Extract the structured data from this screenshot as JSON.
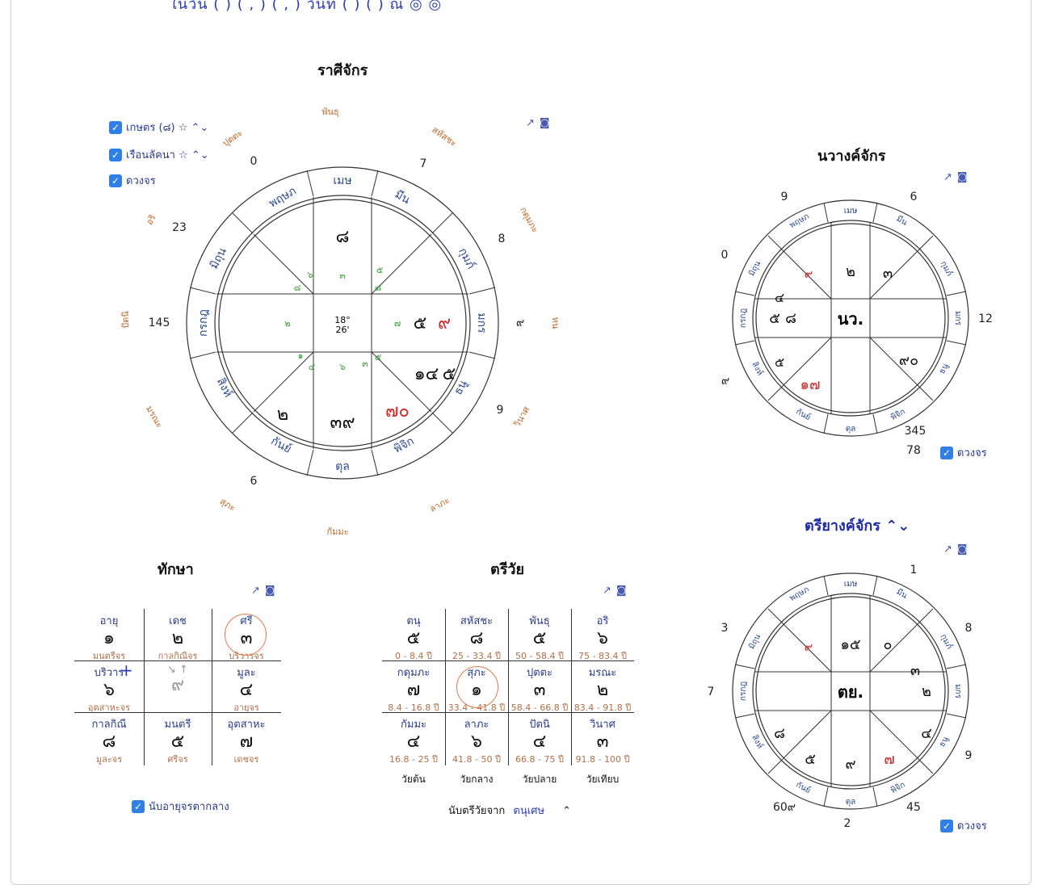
{
  "top_line": "ในวัน (     )  (          ,    )  (     ,          )  วันที่ (        ) (        )  ณ ◎ ◎",
  "rasi": {
    "title": "ราศีจักร",
    "cb1": "เกษตร (๘) ☆ ⌃⌄",
    "cb2": "เรือนลัคนา ☆ ⌃⌄",
    "cb3": "ดวงจร",
    "outer_words": [
      "พันธุ",
      "สหัสชะ",
      "กดุมภะ",
      "ทน",
      "วินาศ",
      "ลาภะ",
      "กัมมะ",
      "สุภะ",
      "มรณะ",
      "ปัตนิ",
      "อริ",
      "ปุตตะ"
    ],
    "outer_nums": [
      "7",
      "8",
      "๙",
      "9",
      "6",
      "145",
      "23",
      "0"
    ],
    "signs": [
      "เมษ",
      "มีน",
      "กุมภ์",
      "มกร",
      "ธนู",
      "พิจิก",
      "ตุล",
      "กันย์",
      "สิงห์",
      "กรกฎ",
      "มิถุน",
      "พฤษภ"
    ],
    "center_deg": "18°",
    "center_min": "26'",
    "big": [
      "๘",
      "๕",
      "๙",
      "๑๔",
      "๕",
      "๗๐",
      "๓๙",
      "๒"
    ],
    "green": [
      "๓",
      "๕",
      "๘",
      "๗",
      "๕",
      "๓",
      "๖",
      "๔",
      "๑",
      "๒",
      "๘",
      "๖"
    ]
  },
  "nava": {
    "title": "นวางค์จักร",
    "center": "นว.",
    "nums": [
      "9",
      "6",
      "0",
      "12",
      "๙",
      "345",
      "78"
    ],
    "cb": "ดวงจร",
    "cells": [
      "๙",
      "๒",
      "๓",
      "๔",
      "๕",
      "๘",
      "๙๐",
      "๕",
      "๑๗"
    ]
  },
  "tri": {
    "title": "ตรียางค์จักร ⌃⌄",
    "center": "ตย.",
    "nums": [
      "1",
      "3",
      "8",
      "7",
      "9",
      "60๙",
      "2",
      "45"
    ],
    "cb": "ดวงจร",
    "cells": [
      "๙",
      "๑๕",
      "๐",
      "๓",
      "๒",
      "๘",
      "๔",
      "๕",
      "๙",
      "๗"
    ]
  },
  "taksa": {
    "title": "ทักษา",
    "cells": [
      {
        "n": "อายุ",
        "v": "๑",
        "s": "มนตรีจร"
      },
      {
        "n": "เดช",
        "v": "๒",
        "s": "กาลกิณีจร"
      },
      {
        "n": "ศรี",
        "v": "๓",
        "s": "บริวารจร"
      },
      {
        "n": "บริวาร",
        "v": "๖",
        "s": "อุตสาหะจร"
      },
      {
        "n": "",
        "v": "๙",
        "s": ""
      },
      {
        "n": "มูละ",
        "v": "๔",
        "s": "อายุจร"
      },
      {
        "n": "กาลกิณี",
        "v": "๘",
        "s": "มูละจร"
      },
      {
        "n": "มนตรี",
        "v": "๕",
        "s": "ศรีจร"
      },
      {
        "n": "อุตสาหะ",
        "v": "๗",
        "s": "เดชจร"
      }
    ],
    "cb": "นับอายุจรตากลาง"
  },
  "triwai": {
    "title": "ตรีวัย",
    "cells": [
      {
        "n": "ตนุ",
        "v": "๕",
        "s": "0 - 8.4 ปี"
      },
      {
        "n": "สหัสชะ",
        "v": "๘",
        "s": "25 - 33.4 ปี"
      },
      {
        "n": "พันธุ",
        "v": "๕",
        "s": "50 - 58.4 ปี"
      },
      {
        "n": "อริ",
        "v": "๖",
        "s": "75 - 83.4 ปี"
      },
      {
        "n": "กดุมภะ",
        "v": "๗",
        "s": "8.4 - 16.8 ปี"
      },
      {
        "n": "สุภะ",
        "v": "๑",
        "s": "33.4 - 41.8 ปี"
      },
      {
        "n": "ปุตตะ",
        "v": "๓",
        "s": "58.4 - 66.8 ปี"
      },
      {
        "n": "มรณะ",
        "v": "๒",
        "s": "83.4 - 91.8 ปี"
      },
      {
        "n": "กัมมะ",
        "v": "๔",
        "s": "16.8 - 25 ปี"
      },
      {
        "n": "ลาภะ",
        "v": "๖",
        "s": "41.8 - 50 ปี"
      },
      {
        "n": "ปัตนิ",
        "v": "๔",
        "s": "66.8 - 75 ปี"
      },
      {
        "n": "วินาศ",
        "v": "๓",
        "s": "91.8 - 100 ปี"
      }
    ],
    "foot": [
      "วัยต้น",
      "วัยกลาง",
      "วัยปลาย",
      "วัยเทียบ"
    ],
    "select_label": "นับตรีวัยจาก",
    "select_value": "ตนุเศษ"
  }
}
